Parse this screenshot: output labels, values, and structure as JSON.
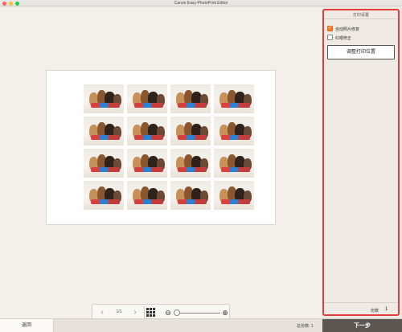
{
  "window": {
    "title": "Canon Easy-PhotoPrint Editor"
  },
  "preview": {
    "rows": 4,
    "cols": 4
  },
  "navigation": {
    "page_info": "1/1",
    "prev_icon": "chevron-left-icon",
    "next_icon": "chevron-right-icon",
    "layout_icon": "grid-icon",
    "zoom_out_icon": "zoom-out-icon",
    "zoom_in_icon": "zoom-in-icon",
    "zoom_level": 0
  },
  "panel": {
    "title": "打印设置",
    "option1": {
      "label": "自动照片修复",
      "checked": true
    },
    "option2": {
      "label": "红眼修正",
      "checked": false
    },
    "adjust_button": "调整打印位置",
    "copies_label": "份数",
    "copies_value": "1"
  },
  "footer": {
    "back_button": "返回",
    "total_copies": "总份数: 1",
    "next_button": "下一步"
  },
  "colors": {
    "accent_orange": "#f07a2a",
    "highlight_red": "#e23c3c",
    "next_button_bg": "#5b5651"
  }
}
